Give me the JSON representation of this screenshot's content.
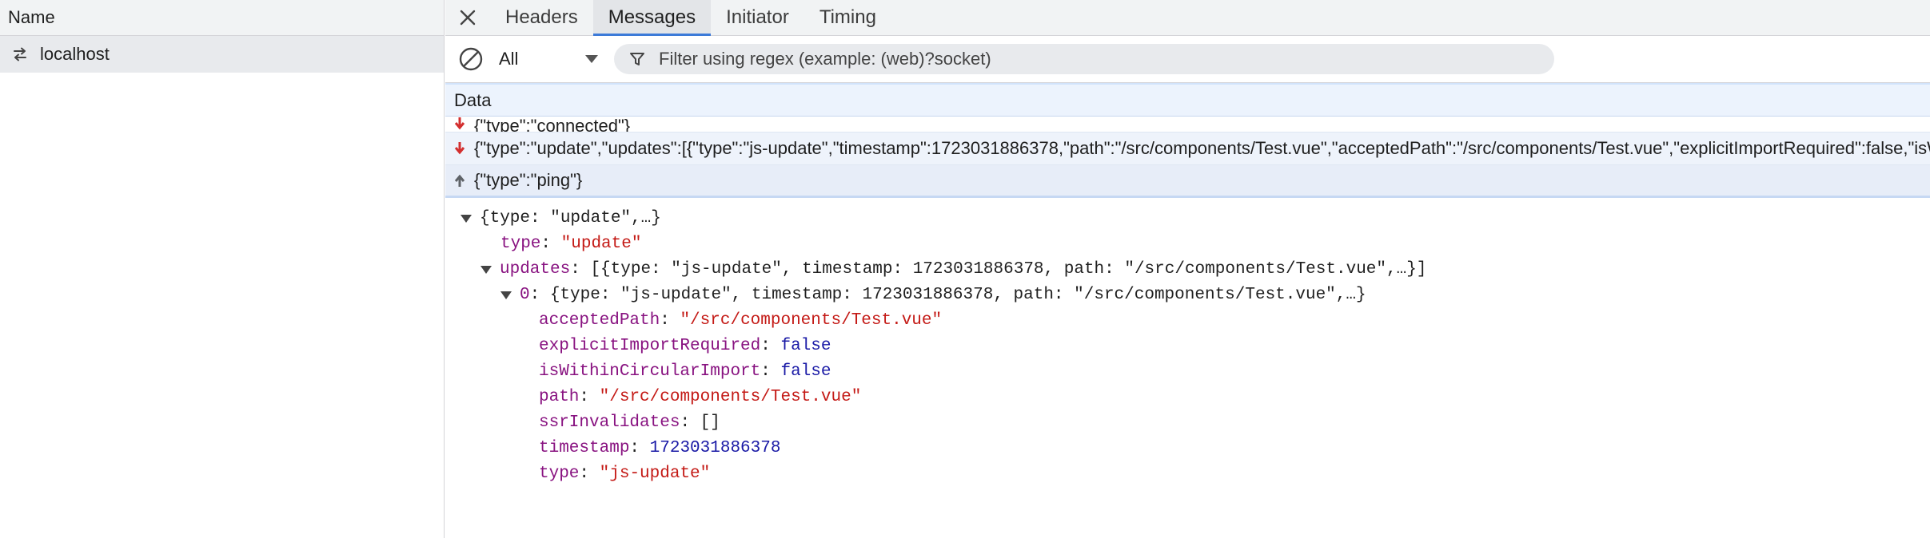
{
  "left_panel": {
    "header": "Name",
    "rows": [
      {
        "label": "localhost",
        "icon": "websocket-arrows-icon"
      }
    ]
  },
  "tabs": {
    "close_icon": "close-icon",
    "items": [
      {
        "label": "Headers",
        "active": false
      },
      {
        "label": "Messages",
        "active": true
      },
      {
        "label": "Initiator",
        "active": false
      },
      {
        "label": "Timing",
        "active": false
      }
    ]
  },
  "filter": {
    "clear_icon": "block-icon",
    "type_value": "All",
    "placeholder": "Filter using regex (example: (web)?socket)"
  },
  "data_header": "Data",
  "messages": [
    {
      "direction": "received",
      "text": "{\"type\":\"connected\"}"
    },
    {
      "direction": "received",
      "text": "{\"type\":\"update\",\"updates\":[{\"type\":\"js-update\",\"timestamp\":1723031886378,\"path\":\"/src/components/Test.vue\",\"acceptedPath\":\"/src/components/Test.vue\",\"explicitImportRequired\":false,\"isWithinCircularImport\":false,\"ssrInvalidates\":[]}]}"
    },
    {
      "direction": "sent",
      "text": "{\"type\":\"ping\"}"
    }
  ],
  "tree": {
    "root_preview": "{type: \"update\",…}",
    "type_key": "type",
    "type_value": "\"update\"",
    "updates_key": "updates",
    "updates_preview": "[{type: \"js-update\", timestamp: 1723031886378, path: \"/src/components/Test.vue\",…}]",
    "item_key": "0",
    "item_preview": "{type: \"js-update\", timestamp: 1723031886378, path: \"/src/components/Test.vue\",…}",
    "fields": [
      {
        "key": "acceptedPath",
        "value": "\"/src/components/Test.vue\"",
        "kind": "str"
      },
      {
        "key": "explicitImportRequired",
        "value": "false",
        "kind": "bool"
      },
      {
        "key": "isWithinCircularImport",
        "value": "false",
        "kind": "bool"
      },
      {
        "key": "path",
        "value": "\"/src/components/Test.vue\"",
        "kind": "str"
      },
      {
        "key": "ssrInvalidates",
        "value": "[]",
        "kind": "punct"
      },
      {
        "key": "timestamp",
        "value": "1723031886378",
        "kind": "num"
      },
      {
        "key": "type",
        "value": "\"js-update\"",
        "kind": "str"
      }
    ]
  },
  "colors": {
    "accent": "#3c7ad8",
    "received_arrow": "#d32f2f",
    "sent_arrow": "#5f6368"
  }
}
